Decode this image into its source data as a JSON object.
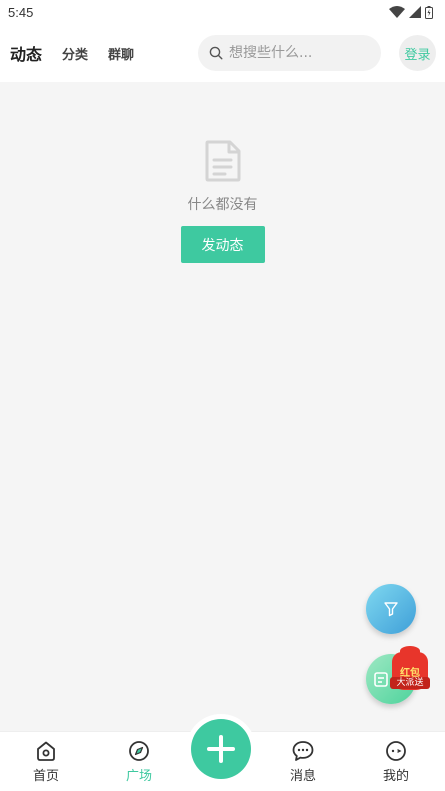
{
  "status_bar": {
    "time": "5:45"
  },
  "header": {
    "tabs": [
      {
        "label": "动态",
        "active": true
      },
      {
        "label": "分类",
        "active": false
      },
      {
        "label": "群聊",
        "active": false
      }
    ],
    "search": {
      "placeholder": "想搜些什么..."
    },
    "login_label": "登录"
  },
  "empty_state": {
    "icon": "document-icon",
    "text": "什么都没有",
    "button_label": "发动态"
  },
  "floating": {
    "filter_icon": "filter-icon",
    "edit_icon": "edit-icon",
    "red_packet": {
      "title": "红包",
      "subtitle": "大派送"
    }
  },
  "tab_bar": {
    "items": [
      {
        "label": "首页",
        "icon": "home-icon",
        "active": false
      },
      {
        "label": "广场",
        "icon": "compass-icon",
        "active": true
      },
      {
        "label": "消息",
        "icon": "chat-icon",
        "active": false
      },
      {
        "label": "我的",
        "icon": "profile-icon",
        "active": false
      }
    ],
    "center_icon": "plus-icon"
  },
  "colors": {
    "accent": "#3ec9a0",
    "background": "#f5f5f5"
  }
}
